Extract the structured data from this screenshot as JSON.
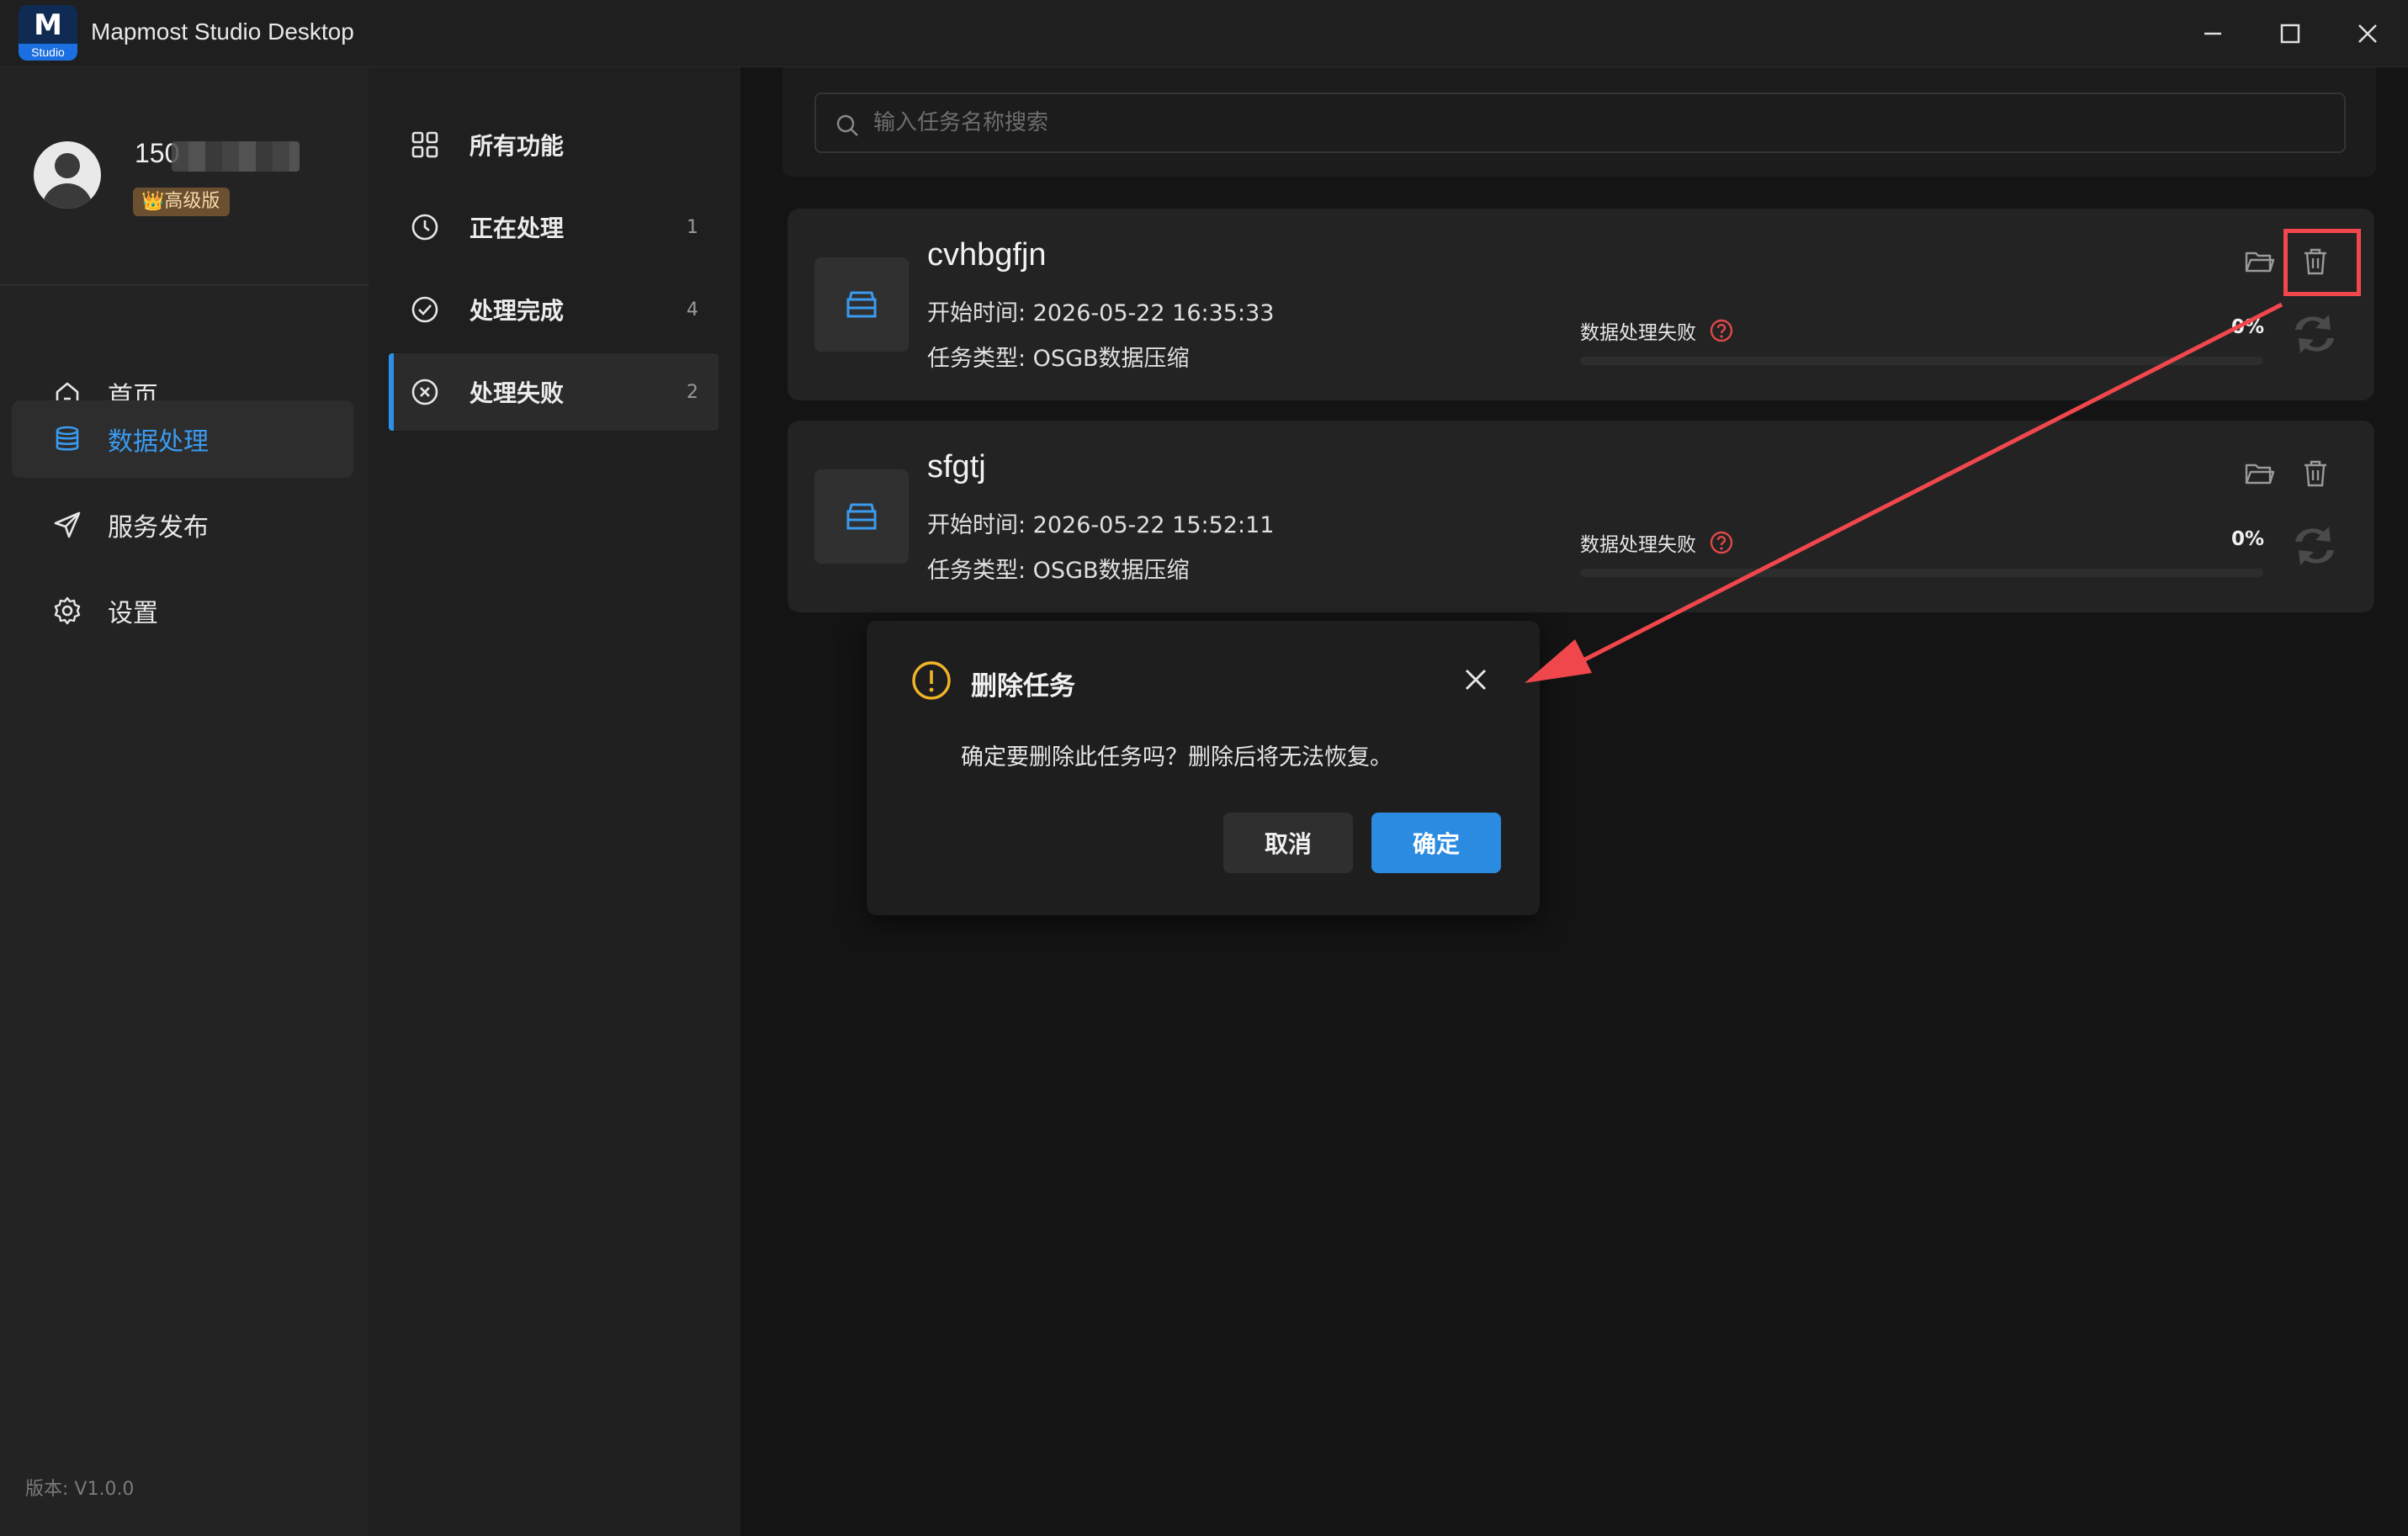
{
  "app": {
    "title": "Mapmost Studio Desktop",
    "logo_text": "M",
    "logo_sub": "Studio"
  },
  "user": {
    "name_visible": "150",
    "badge": "👑高级版"
  },
  "sidebar": {
    "items": [
      {
        "label": "首页",
        "icon": "home-icon"
      },
      {
        "label": "数据处理",
        "icon": "database-icon",
        "active": true
      },
      {
        "label": "服务发布",
        "icon": "send-icon"
      },
      {
        "label": "设置",
        "icon": "gear-icon"
      }
    ],
    "version": "版本: V1.0.0"
  },
  "subnav": {
    "items": [
      {
        "label": "所有功能",
        "count": "",
        "icon": "grid-icon"
      },
      {
        "label": "正在处理",
        "count": "1",
        "icon": "clock-icon"
      },
      {
        "label": "处理完成",
        "count": "4",
        "icon": "check-circle-icon"
      },
      {
        "label": "处理失败",
        "count": "2",
        "icon": "x-circle-icon",
        "active": true
      }
    ]
  },
  "search": {
    "placeholder": "输入任务名称搜索"
  },
  "tasks": [
    {
      "name": "cvhbgfjn",
      "start": "开始时间: 2026-05-22 16:35:33",
      "type": "任务类型: OSGB数据压缩",
      "status": "数据处理失败",
      "progress": "0%",
      "progress_value": 0
    },
    {
      "name": "sfgtj",
      "start": "开始时间: 2026-05-22 15:52:11",
      "type": "任务类型: OSGB数据压缩",
      "status": "数据处理失败",
      "progress": "0%",
      "progress_value": 0
    }
  ],
  "dialog": {
    "title": "删除任务",
    "message": "确定要删除此任务吗？删除后将无法恢复。",
    "cancel": "取消",
    "confirm": "确定"
  },
  "colors": {
    "accent": "#2b8be0",
    "error": "#e04848",
    "warning": "#f0b429",
    "annotation": "#f0474d"
  }
}
